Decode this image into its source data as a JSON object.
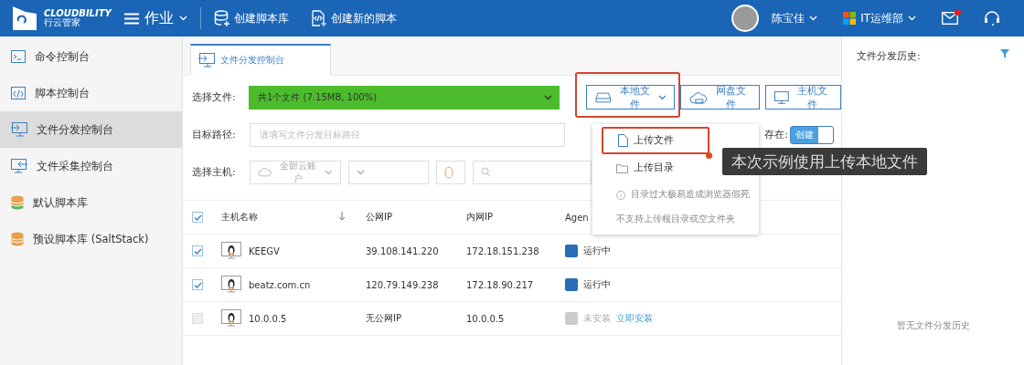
{
  "header": {
    "logo_text": "CLOUDBILITY",
    "logo_subtext": "行云管家",
    "menu": "作业",
    "actions": [
      {
        "label": "创建脚本库",
        "kind": "database"
      },
      {
        "label": "创建新的脚本",
        "kind": "script"
      }
    ],
    "user": "陈宝佳",
    "org": "IT运维部",
    "mail_unread": true
  },
  "sidebar": {
    "items": [
      {
        "label": "命令控制台",
        "kind": "terminal",
        "selected": false
      },
      {
        "label": "脚本控制台",
        "kind": "code",
        "selected": false
      },
      {
        "label": "文件分发控制台",
        "kind": "transfer",
        "selected": true
      },
      {
        "label": "文件采集控制台",
        "kind": "collect",
        "selected": false
      },
      {
        "label": "默认脚本库",
        "kind": "db-green",
        "selected": false
      },
      {
        "label": "预设脚本库 (SaltStack)",
        "kind": "db-orange",
        "selected": false
      }
    ]
  },
  "tabs": [
    {
      "label": "文件分发控制台",
      "selected": true
    }
  ],
  "form": {
    "file_label": "选择文件:",
    "file_value": "共1个文件 (7.15MB, 100%)",
    "file_buttons": [
      {
        "label": "本地文件",
        "kind": "local",
        "caret": true,
        "highlighted": true
      },
      {
        "label": "网盘文件",
        "kind": "cloud",
        "caret": false,
        "highlighted": false
      },
      {
        "label": "主机文件",
        "kind": "host",
        "caret": false,
        "highlighted": false
      }
    ],
    "path_label": "目标路径:",
    "path_placeholder": "请填写文件分发目标路径",
    "exists_label": "存在:",
    "exists_toggle": {
      "label": "创建",
      "on": true
    },
    "host_label": "选择主机:",
    "cloud_account": "全部云账户"
  },
  "dropdown": {
    "items": [
      {
        "label": "上传文件",
        "kind": "file",
        "highlighted": true
      },
      {
        "label": "上传目录",
        "kind": "folder",
        "highlighted": false
      }
    ],
    "notes": [
      {
        "text": "目录过大极易造成浏览器假死",
        "kind": "info"
      },
      {
        "text": "不支持上传根目录或空文件夹",
        "kind": "plain"
      }
    ]
  },
  "table": {
    "all_checked": true,
    "columns": [
      "主机名称",
      "公网IP",
      "内网IP",
      "Agen"
    ],
    "rows": [
      {
        "checked": true,
        "name": "KEEGV",
        "public_ip": "39.108.141.220",
        "private_ip": "172.18.151.238",
        "agent_status": "运行中",
        "agent_running": true
      },
      {
        "checked": true,
        "name": "beatz.com.cn",
        "public_ip": "120.79.149.238",
        "private_ip": "172.18.90.217",
        "agent_status": "运行中",
        "agent_running": true
      },
      {
        "checked": false,
        "name": "10.0.0.5",
        "public_ip": "无公网IP",
        "private_ip": "10.0.0.5",
        "agent_status": "未安装",
        "agent_running": false,
        "install_link": "立即安装"
      }
    ]
  },
  "history": {
    "title": "文件分发历史:",
    "empty": "暂无文件分发历史"
  },
  "callout": "本次示例使用上传本地文件"
}
